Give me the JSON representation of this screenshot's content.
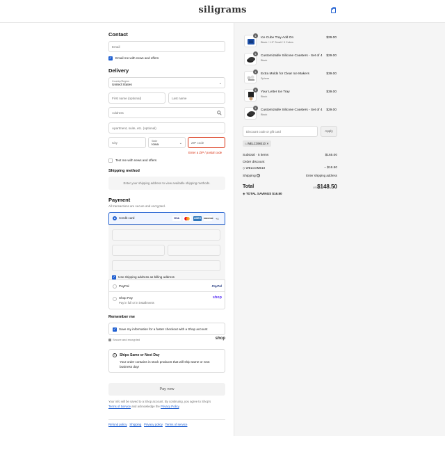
{
  "header": {
    "logo": "siligrams",
    "cart_icon": "shopping-bag-icon"
  },
  "contact": {
    "title": "Contact",
    "email_placeholder": "Email",
    "newsletter_label": "Email me with news and offers",
    "newsletter_checked": true
  },
  "delivery": {
    "title": "Delivery",
    "country_label": "Country/Region",
    "country_value": "United States",
    "first_name_placeholder": "First name (optional)",
    "last_name_placeholder": "Last name",
    "address_placeholder": "Address",
    "apartment_placeholder": "Apartment, suite, etc. (optional)",
    "city_placeholder": "City",
    "state_label": "State",
    "state_value": "Iowa",
    "zip_placeholder": "ZIP code",
    "zip_error": "Enter a ZIP / postal code",
    "text_offers_label": "Text me with news and offers"
  },
  "shipping_method": {
    "title": "Shipping method",
    "message": "Enter your shipping address to view available shipping methods."
  },
  "payment": {
    "title": "Payment",
    "subtitle": "All transactions are secure and encrypted.",
    "credit_card_label": "Credit card",
    "card_brands": [
      "VISA",
      "MC",
      "AMEX",
      "DISCOVER",
      "+4"
    ],
    "billing_same_label": "Use shipping address as billing address",
    "paypal_label": "PayPal",
    "paypal_logo": "PayPal",
    "shoppay_label": "Shop Pay",
    "shoppay_sub": "Pay in full or in installments",
    "shoppay_logo": "shop"
  },
  "remember": {
    "title": "Remember me",
    "save_label": "Save my information for a faster checkout with a Shop account",
    "secure_label": "Secure and encrypted",
    "shop_logo": "shop"
  },
  "notice": {
    "title": "Ships Same or Next Day",
    "body": "Your order contains in stock products that will ship same or next business day!"
  },
  "pay_button": "Pay now",
  "legal": {
    "text_before": "Your info will be saved to a Shop account. By continuing, you agree to Shop's",
    "terms": "Terms of Service",
    "and_ack": "and acknowledge the",
    "privacy": "Privacy Policy",
    "period": "."
  },
  "footer_links": [
    "Refund policy",
    "Shipping",
    "Privacy policy",
    "Terms of service"
  ],
  "cart": {
    "items": [
      {
        "name": "Ice Cube Tray Add On",
        "variant": "Black / 1.5\" Small / 3 Cubes",
        "qty": "1",
        "price": "$29.00"
      },
      {
        "name": "Customizable Silicone Coasters - Set of 4",
        "variant": "Black",
        "qty": "1",
        "price": "$29.00"
      },
      {
        "name": "Extra Molds for Clear Ice Makers",
        "variant": "Sphere",
        "qty": "1",
        "price": "$39.00"
      },
      {
        "name": "Your Letter Ice Tray",
        "variant": "Black",
        "qty": "1",
        "price": "$39.00"
      },
      {
        "name": "Customizable Silicone Coasters - Set of 4",
        "variant": "Black",
        "qty": "1",
        "price": "$29.00"
      }
    ],
    "discount_placeholder": "Discount code or gift card",
    "apply_label": "Apply",
    "applied_code": "WELCOME10",
    "subtotal_label": "Subtotal · 5 items",
    "subtotal_value": "$165.00",
    "order_discount_label": "Order discount",
    "discount_code": "WELCOME10",
    "discount_value": "– $16.50",
    "shipping_label": "Shipping",
    "shipping_value": "Enter shipping address",
    "total_label": "Total",
    "currency": "USD",
    "total_value": "$148.50",
    "savings_label": "TOTAL SAVINGS",
    "savings_value": "$16.50"
  },
  "colors": {
    "accent": "#1f5fd1",
    "error": "#d82c0d",
    "panel": "#f5f5f5"
  }
}
